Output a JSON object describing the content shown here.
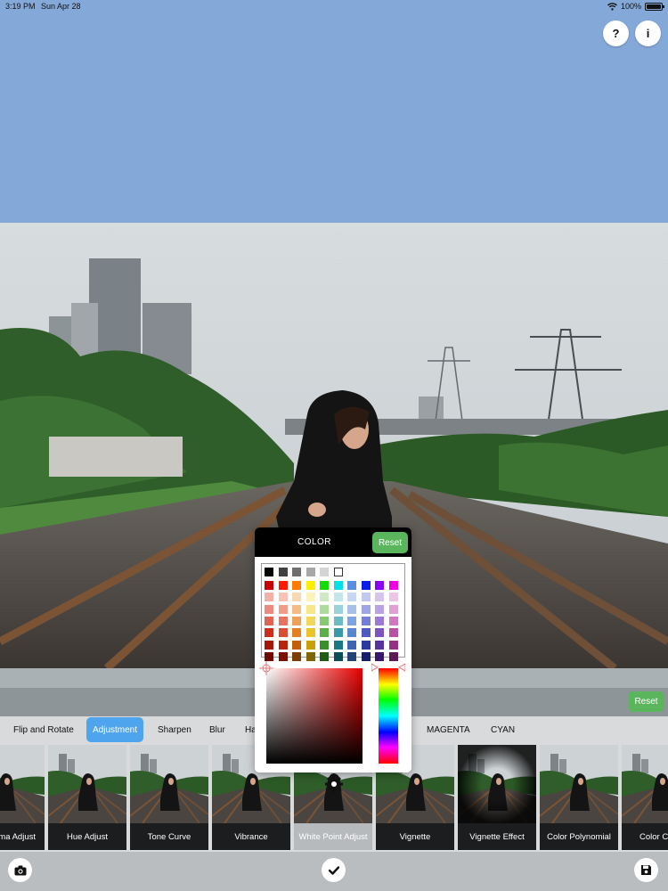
{
  "status": {
    "time": "3:19 PM",
    "date": "Sun Apr 28",
    "battery": "100%"
  },
  "header": {
    "help_label": "?",
    "info_label": "i"
  },
  "adjust_reset_label": "Reset",
  "categories": [
    {
      "label": "Flip and Rotate"
    },
    {
      "label": "Adjustment"
    },
    {
      "label": "Sharpen"
    },
    {
      "label": "Blur"
    },
    {
      "label": "Ha"
    },
    {
      "label": "MAGENTA"
    },
    {
      "label": "CYAN"
    }
  ],
  "active_category": "Adjustment",
  "filters": [
    {
      "label": "ma Adjust"
    },
    {
      "label": "Hue Adjust"
    },
    {
      "label": "Tone Curve"
    },
    {
      "label": "Vibrance"
    },
    {
      "label": "White Point Adjust"
    },
    {
      "label": "Vignette"
    },
    {
      "label": "Vignette Effect"
    },
    {
      "label": "Color Polynomial"
    },
    {
      "label": "Color C Polyno"
    }
  ],
  "selected_filter": "White Point Adjust",
  "color_picker": {
    "title": "COLOR",
    "reset_label": "Reset",
    "gray_row": [
      "#000000",
      "#404040",
      "#6e6e6e",
      "#a8a8a8",
      "#d4d4d4",
      "#ffffff"
    ],
    "hue_columns": [
      [
        "#c40000",
        "#f3b0a9",
        "#ec8a80",
        "#e06454",
        "#cc2e1e",
        "#a31608",
        "#6e0a00"
      ],
      [
        "#ff1a00",
        "#f6c3b4",
        "#f09d88",
        "#e67360",
        "#d94d34",
        "#b72410",
        "#7a1000"
      ],
      [
        "#ff7a00",
        "#f9d6b4",
        "#f4bb86",
        "#ee9f58",
        "#e57f24",
        "#c25f08",
        "#7e3d00"
      ],
      [
        "#ffee00",
        "#fbf3b8",
        "#f7e788",
        "#f2d85a",
        "#e9c52a",
        "#c8a00a",
        "#806400"
      ],
      [
        "#11dd00",
        "#cfe9c4",
        "#addb9c",
        "#87c873",
        "#5caf48",
        "#3a8f2a",
        "#1f5c14"
      ],
      [
        "#00e0e6",
        "#c4e6ea",
        "#9ad3da",
        "#6bbac4",
        "#3a9aa8",
        "#1a7784",
        "#0b4e58"
      ],
      [
        "#5c8ee0",
        "#c7d7f1",
        "#a6c0ea",
        "#7fa3df",
        "#5a86d0",
        "#3c66b2",
        "#24427a"
      ],
      [
        "#0a1ee8",
        "#c3c8ef",
        "#9ea6e4",
        "#7580d4",
        "#4e5ac0",
        "#2c3aa0",
        "#161f6a"
      ],
      [
        "#8a00f0",
        "#d5c4ee",
        "#bba2e4",
        "#9c7ad4",
        "#7b54c0",
        "#5a32a0",
        "#38186c"
      ],
      [
        "#f000e0",
        "#ecc4e4",
        "#e0a0d4",
        "#cf78bf",
        "#b850a4",
        "#963084",
        "#5e1854"
      ]
    ]
  }
}
